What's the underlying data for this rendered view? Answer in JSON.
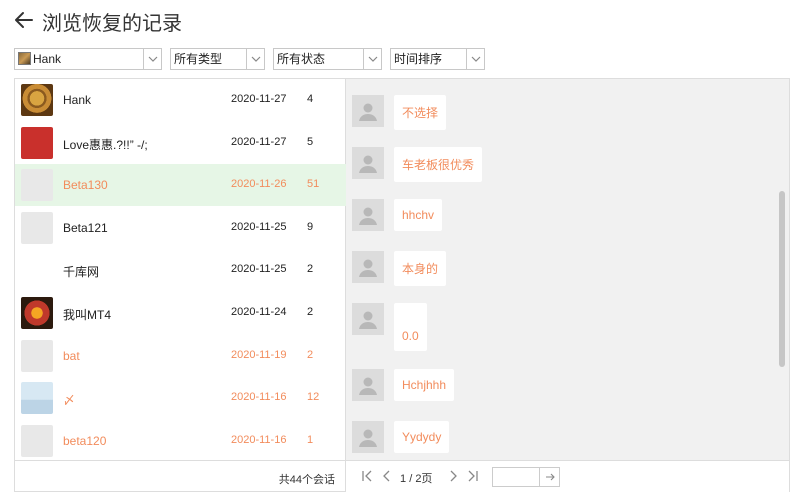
{
  "header": {
    "title": "浏览恢复的记录"
  },
  "filters": {
    "user": "Hank",
    "type": "所有类型",
    "status": "所有状态",
    "sort": "时间排序"
  },
  "conversations": [
    {
      "name": "Hank",
      "date": "2020-11-27",
      "count": "4",
      "avatar": "leopard",
      "orange": false,
      "selected": false
    },
    {
      "name": "Love惠惠.?!!” -/;",
      "date": "2020-11-27",
      "count": "5",
      "avatar": "red",
      "orange": false,
      "selected": false
    },
    {
      "name": "Beta130",
      "date": "2020-11-26",
      "count": "51",
      "avatar": "multi",
      "orange": true,
      "selected": true
    },
    {
      "name": "Beta121",
      "date": "2020-11-25",
      "count": "9",
      "avatar": "multi",
      "orange": false,
      "selected": false
    },
    {
      "name": "千库网",
      "date": "2020-11-25",
      "count": "2",
      "avatar": "kc",
      "orange": false,
      "selected": false
    },
    {
      "name": "我叫MT4",
      "date": "2020-11-24",
      "count": "2",
      "avatar": "mt",
      "orange": false,
      "selected": false
    },
    {
      "name": "bat",
      "date": "2020-11-19",
      "count": "2",
      "avatar": "multi",
      "orange": true,
      "selected": false
    },
    {
      "name": "〆",
      "date": "2020-11-16",
      "count": "12",
      "avatar": "img",
      "orange": true,
      "selected": false
    },
    {
      "name": "beta120",
      "date": "2020-11-16",
      "count": "1",
      "avatar": "multi",
      "orange": true,
      "selected": false
    }
  ],
  "footer": {
    "total": "共44个会话"
  },
  "messages": [
    {
      "text": "不选择"
    },
    {
      "text": "车老板很优秀"
    },
    {
      "text": "hhchv"
    },
    {
      "text": "本身的"
    },
    {
      "text": "0.0"
    },
    {
      "text": "Hchjhhh"
    },
    {
      "text": "Yydydy"
    }
  ],
  "pagination": {
    "current": "1",
    "separator": "/",
    "total": "2页",
    "goto_value": ""
  },
  "colors": {
    "accent": "#f28c5c",
    "selected_row": "#e6f6e6",
    "chat_bg": "#f1f1f1"
  }
}
